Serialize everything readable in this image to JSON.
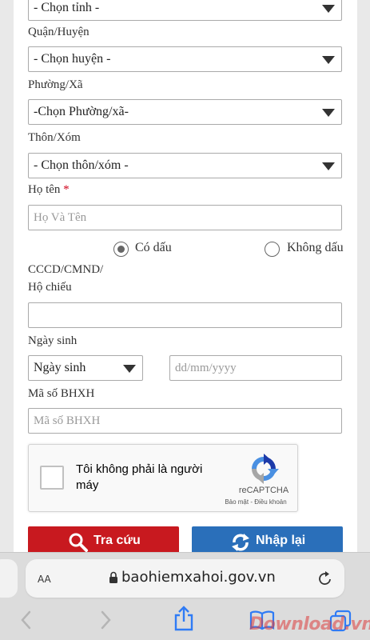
{
  "form": {
    "province_select": {
      "value": "- Chọn tỉnh -"
    },
    "district": {
      "label": "Quận/Huyện",
      "value": "- Chọn huyện -"
    },
    "ward": {
      "label": "Phường/Xã",
      "value": "-Chọn Phường/xã-"
    },
    "hamlet": {
      "label": "Thôn/Xóm",
      "value": "- Chọn thôn/xóm -"
    },
    "full_name": {
      "label": "Họ tên",
      "required_mark": "*",
      "placeholder": "Họ Và Tên"
    },
    "accent_options": {
      "with_accent": "Có dấu",
      "without_accent": "Không dấu",
      "selected": "with_accent"
    },
    "id_number": {
      "label_line1": "CCCD/CMND/",
      "label_line2": "Hộ chiếu",
      "value": ""
    },
    "birth": {
      "label": "Ngày sinh",
      "select_value": "Ngày sinh",
      "date_placeholder": "dd/mm/yyyy"
    },
    "insurance_code": {
      "label": "Mã số BHXH",
      "placeholder": "Mã số BHXH"
    }
  },
  "captcha": {
    "text": "Tôi không phải là người máy",
    "brand": "reCAPTCHA",
    "links": "Bảo mật - Điều khoản"
  },
  "buttons": {
    "search": {
      "label": "Tra cứu",
      "color": "#c8191f"
    },
    "reset": {
      "label": "Nhập lại",
      "color": "#2a6fba"
    }
  },
  "browser": {
    "aa_label": "AA",
    "url": "baohiemxahoi.gov.vn",
    "watermark": "Download.vn"
  }
}
